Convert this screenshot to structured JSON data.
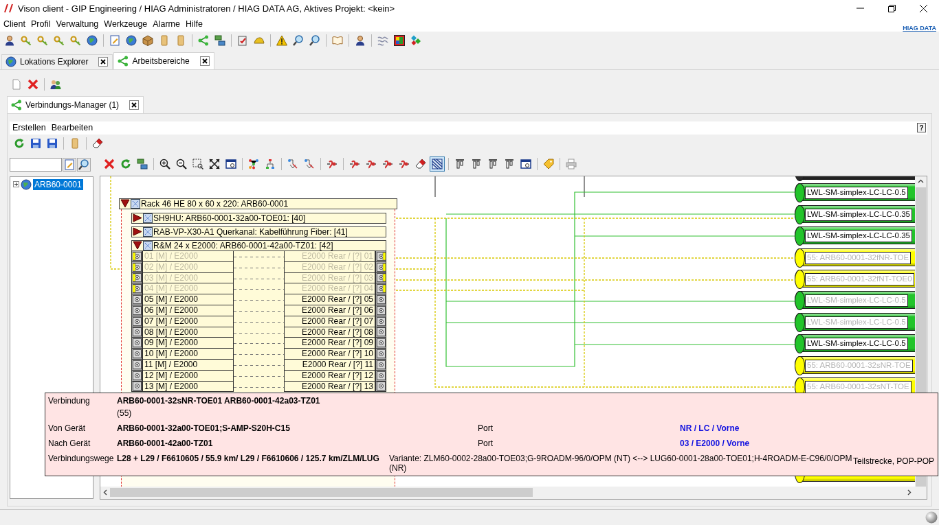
{
  "window": {
    "title": "Vison client - GIP Engineering / HIAG Administratoren / HIAG DATA AG, Aktives Projekt: <kein>"
  },
  "menu": [
    "Client",
    "Profil",
    "Verwaltung",
    "Werkzeuge",
    "Alarme",
    "Hilfe"
  ],
  "brand": "HIAG DATA",
  "tabs": [
    {
      "label": "Lokations Explorer",
      "selected": false
    },
    {
      "label": "Arbeitsbereiche",
      "selected": true
    }
  ],
  "inner_tabs": [
    {
      "label": "Verbindungs-Manager (1)",
      "selected": true
    }
  ],
  "manager_menu": [
    "Erstellen",
    "Bearbeiten"
  ],
  "help_button": "?",
  "tree": {
    "items": [
      {
        "label": "ARB60-0001",
        "selected": true,
        "expanded": false
      }
    ]
  },
  "diagram_toolbar": [
    [
      {
        "selected": false
      },
      {
        "selected": false
      },
      {
        "selected": false
      }
    ],
    [
      {
        "selected": false
      },
      {
        "selected": false
      },
      {
        "selected": false
      },
      {
        "selected": false
      },
      {
        "selected": false
      }
    ],
    [
      {
        "selected": false
      },
      {
        "selected": false
      }
    ],
    [
      {
        "selected": false
      },
      {
        "selected": false
      }
    ],
    [
      {
        "selected": false
      }
    ],
    [
      {
        "selected": false
      },
      {
        "selected": false
      },
      {
        "selected": false
      },
      {
        "selected": false
      },
      {
        "selected": false
      },
      {
        "selected": true
      }
    ],
    [
      {
        "selected": false
      },
      {
        "selected": false
      },
      {
        "selected": false
      },
      {
        "selected": false
      },
      {
        "selected": false
      }
    ],
    [
      {
        "selected": false
      }
    ],
    [
      {
        "selected": false
      }
    ]
  ],
  "diagram": {
    "rack": {
      "label": "Rack 46 HE 80 x 60 x 220: ARB60-0001",
      "expanded": true,
      "devices": [
        {
          "label": "SH9HU: ARB60-0001-32a00-TOE01: [40]",
          "expanded": false
        },
        {
          "label": "RAB-VP-X30-A1 Querkanal: Kabelführung Fiber: [41]",
          "expanded": false
        },
        {
          "label": "R&M 24 x E2000: ARB60-0001-42a00-TZ01: [42]",
          "expanded": true,
          "ports": [
            {
              "front": "01 [M] / E2000",
              "rear": "E2000 Rear / [?] 01",
              "dimmed": true
            },
            {
              "front": "02 [M] / E2000",
              "rear": "E2000 Rear / [?] 02",
              "dimmed": true
            },
            {
              "front": "03 [M] / E2000",
              "rear": "E2000 Rear / [?] 03",
              "dimmed": true
            },
            {
              "front": "04 [M] / E2000",
              "rear": "E2000 Rear / [?] 04",
              "dimmed": true
            },
            {
              "front": "05 [M] / E2000",
              "rear": "E2000 Rear / [?] 05",
              "dimmed": false
            },
            {
              "front": "06 [M] / E2000",
              "rear": "E2000 Rear / [?] 06",
              "dimmed": false
            },
            {
              "front": "07 [M] / E2000",
              "rear": "E2000 Rear / [?] 07",
              "dimmed": false
            },
            {
              "front": "08 [M] / E2000",
              "rear": "E2000 Rear / [?] 08",
              "dimmed": false
            },
            {
              "front": "09 [M] / E2000",
              "rear": "E2000 Rear / [?] 09",
              "dimmed": false
            },
            {
              "front": "10 [M] / E2000",
              "rear": "E2000 Rear / [?] 10",
              "dimmed": false
            },
            {
              "front": "11 [M] / E2000",
              "rear": "E2000 Rear / [?] 11",
              "dimmed": false
            },
            {
              "front": "12 [M] / E2000",
              "rear": "E2000 Rear / [?] 12",
              "dimmed": false
            },
            {
              "front": "13 [M] / E2000",
              "rear": "E2000 Rear / [?] 13",
              "dimmed": false
            }
          ]
        }
      ]
    },
    "cables": [
      {
        "color": "#2a2a2a"
      },
      {
        "label": "LWL-SM-simplex-LC-LC-0.5",
        "color": "#22c42a",
        "faded": false
      },
      {
        "label": "LWL-SM-simplex-LC-LC-0.35",
        "color": "#22c42a",
        "faded": false
      },
      {
        "label": "LWL-SM-simplex-LC-LC-0.35",
        "color": "#22c42a",
        "faded": false
      },
      {
        "label": "55: ARB60-0001-32fNR-TOE",
        "color": "#ffff00",
        "faded": true
      },
      {
        "label": "55: ARB60-0001-32fNT-TOE0",
        "color": "#ffff00",
        "faded": true
      },
      {
        "label": "LWL-SM-simplex-LC-LC-0.5",
        "color": "#22c42a",
        "faded": true
      },
      {
        "label": "LWL-SM-simplex-LC-LC-0.5",
        "color": "#22c42a",
        "faded": true
      },
      {
        "label": "LWL-SM-simplex-LC-LC-0.5",
        "color": "#22c42a",
        "faded": false
      },
      {
        "label": "55: ARB60-0001-32sNR-TOE",
        "color": "#ffff00",
        "faded": true
      },
      {
        "label": "55: ARB60-0001-32sNT-TOE",
        "color": "#ffff00",
        "faded": true
      }
    ],
    "cables_below": [
      {
        "color": "#ffff00"
      }
    ]
  },
  "tooltip": {
    "connection": {
      "label": "Verbindung",
      "value": "ARB60-0001-32sNR-TOE01 ARB60-0001-42a03-TZ01",
      "note": "(55)"
    },
    "from": {
      "label": "Von Gerät",
      "value": "ARB60-0001-32a00-TOE01;S-AMP-S20H-C15",
      "port_label": "Port",
      "port": "NR / LC / Vorne"
    },
    "to": {
      "label": "Nach Gerät",
      "value": "ARB60-0001-42a00-TZ01",
      "port_label": "Port",
      "port": "03 / E2000 / Vorne"
    },
    "routes": {
      "label": "Verbindungswege",
      "value": "L28 + L29 / F6610605 / 55.9 km/ L29 / F6610606 / 125.7 km/ZLM/LUG",
      "variant": "Variante: ZLM60-0002-28a00-TOE03;G-9ROADM-96/0/OPM (NT) <--> LUG60-0001-28a00-TOE01;H-4ROADM-E-C96/0/OPM (NR)",
      "segment": "Teilstrecke, POP-POP"
    }
  }
}
